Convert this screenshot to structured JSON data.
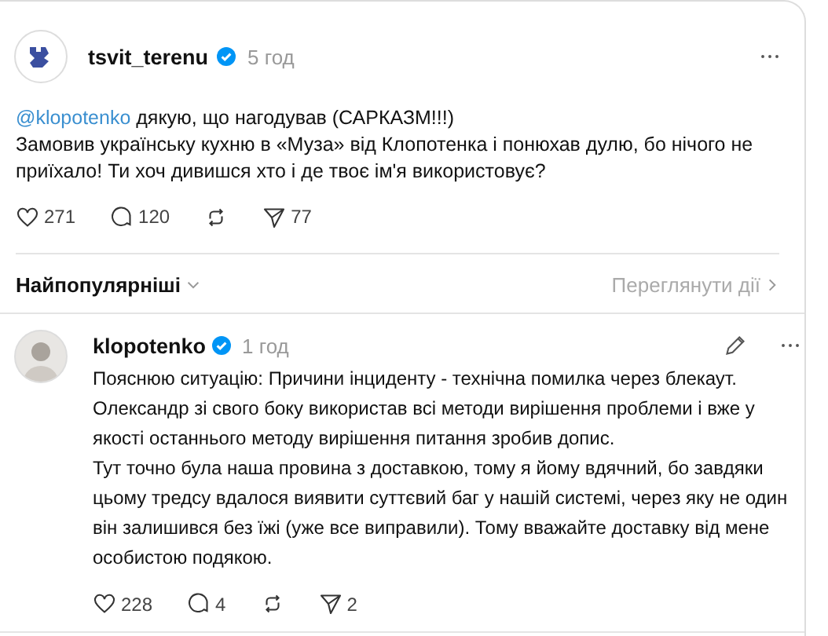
{
  "post": {
    "author": "tsvit_terenu",
    "verified": true,
    "time": "5 год",
    "mention": "@klopotenko",
    "first_line": "дякую, що нагодував (САРКАЗМ!!!)",
    "paragraph": "Замовив українську кухню в «Муза» від Клопотенка і понюхав дулю, бо нічого не приїхало! Ти хоч дивишся хто і де твоє ім'я використовує?",
    "stats": [
      {
        "kind": "like",
        "count": "271"
      },
      {
        "kind": "comment",
        "count": "120"
      },
      {
        "kind": "repost"
      },
      {
        "kind": "share",
        "count": "77"
      }
    ]
  },
  "sort": {
    "label": "Найпопулярніші",
    "activity_link": "Переглянути дії"
  },
  "reply": {
    "author": "klopotenko",
    "verified": true,
    "time": "1 год",
    "editable": true,
    "paragraphs": [
      "Пояснюю ситуацію: Причини інциденту - технічна помилка через блекаут. Олександр зі свого боку використав всі методи вирішення проблеми і вже у якості останнього методу вирішення питання зробив допис.",
      "Тут точно була наша провина з доставкою, тому я йому вдячний, бо завдяки цьому тредсу вдалося виявити суттєвий баг у нашій системі, через яку не один він залишився без їжі (уже все виправили). Тому вважайте доставку від мене особистою подякою."
    ],
    "stats": [
      {
        "kind": "like",
        "count": "228"
      },
      {
        "kind": "comment",
        "count": "4"
      },
      {
        "kind": "repost"
      },
      {
        "kind": "share",
        "count": "2"
      }
    ]
  }
}
